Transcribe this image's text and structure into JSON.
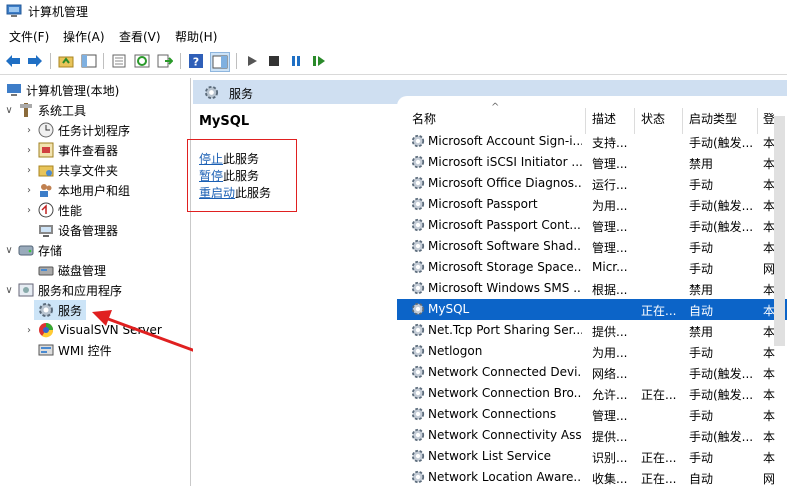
{
  "window": {
    "title": "计算机管理"
  },
  "menu": [
    "文件(F)",
    "操作(A)",
    "查看(V)",
    "帮助(H)"
  ],
  "tree": {
    "root": "计算机管理(本地)",
    "system_tools": "系统工具",
    "system_children": [
      "任务计划程序",
      "事件查看器",
      "共享文件夹",
      "本地用户和组",
      "性能",
      "设备管理器"
    ],
    "storage": "存储",
    "disk": "磁盘管理",
    "services_apps": "服务和应用程序",
    "services": "服务",
    "visualsvn": "VisualSVN Server",
    "wmi": "WMI 控件"
  },
  "header": {
    "label": "服务"
  },
  "detail": {
    "title": "MySQL",
    "actions": [
      {
        "link": "停止",
        "rest": "此服务"
      },
      {
        "link": "暂停",
        "rest": "此服务"
      },
      {
        "link": "重启动",
        "rest": "此服务"
      }
    ]
  },
  "columns": {
    "name": "名称",
    "desc": "描述",
    "status": "状态",
    "startup": "启动类型",
    "logon": "登"
  },
  "services": [
    {
      "name": "Microsoft Account Sign-i...",
      "desc": "支持...",
      "status": "",
      "startup": "手动(触发...",
      "logon": "本"
    },
    {
      "name": "Microsoft iSCSI Initiator ...",
      "desc": "管理...",
      "status": "",
      "startup": "禁用",
      "logon": "本"
    },
    {
      "name": "Microsoft Office Diagnos...",
      "desc": "运行...",
      "status": "",
      "startup": "手动",
      "logon": "本"
    },
    {
      "name": "Microsoft Passport",
      "desc": "为用...",
      "status": "",
      "startup": "手动(触发...",
      "logon": "本"
    },
    {
      "name": "Microsoft Passport Cont...",
      "desc": "管理...",
      "status": "",
      "startup": "手动(触发...",
      "logon": "本"
    },
    {
      "name": "Microsoft Software Shad...",
      "desc": "管理...",
      "status": "",
      "startup": "手动",
      "logon": "本"
    },
    {
      "name": "Microsoft Storage Space...",
      "desc": "Micr...",
      "status": "",
      "startup": "手动",
      "logon": "网"
    },
    {
      "name": "Microsoft Windows SMS ...",
      "desc": "根据...",
      "status": "",
      "startup": "禁用",
      "logon": "本"
    },
    {
      "name": "MySQL",
      "desc": "",
      "status": "正在...",
      "startup": "自动",
      "logon": "本",
      "selected": true
    },
    {
      "name": "Net.Tcp Port Sharing Ser...",
      "desc": "提供...",
      "status": "",
      "startup": "禁用",
      "logon": "本"
    },
    {
      "name": "Netlogon",
      "desc": "为用...",
      "status": "",
      "startup": "手动",
      "logon": "本"
    },
    {
      "name": "Network Connected Devi...",
      "desc": "网络...",
      "status": "",
      "startup": "手动(触发...",
      "logon": "本"
    },
    {
      "name": "Network Connection Bro...",
      "desc": "允许...",
      "status": "正在...",
      "startup": "手动(触发...",
      "logon": "本"
    },
    {
      "name": "Network Connections",
      "desc": "管理...",
      "status": "",
      "startup": "手动",
      "logon": "本"
    },
    {
      "name": "Network Connectivity Ass...",
      "desc": "提供...",
      "status": "",
      "startup": "手动(触发...",
      "logon": "本"
    },
    {
      "name": "Network List Service",
      "desc": "识别...",
      "status": "正在...",
      "startup": "手动",
      "logon": "本"
    },
    {
      "name": "Network Location Aware...",
      "desc": "收集...",
      "status": "正在...",
      "startup": "自动",
      "logon": "网"
    }
  ],
  "colors": {
    "selection": "#0c64c8",
    "header_strip": "#cfdff1",
    "annotation": "#e02020"
  }
}
